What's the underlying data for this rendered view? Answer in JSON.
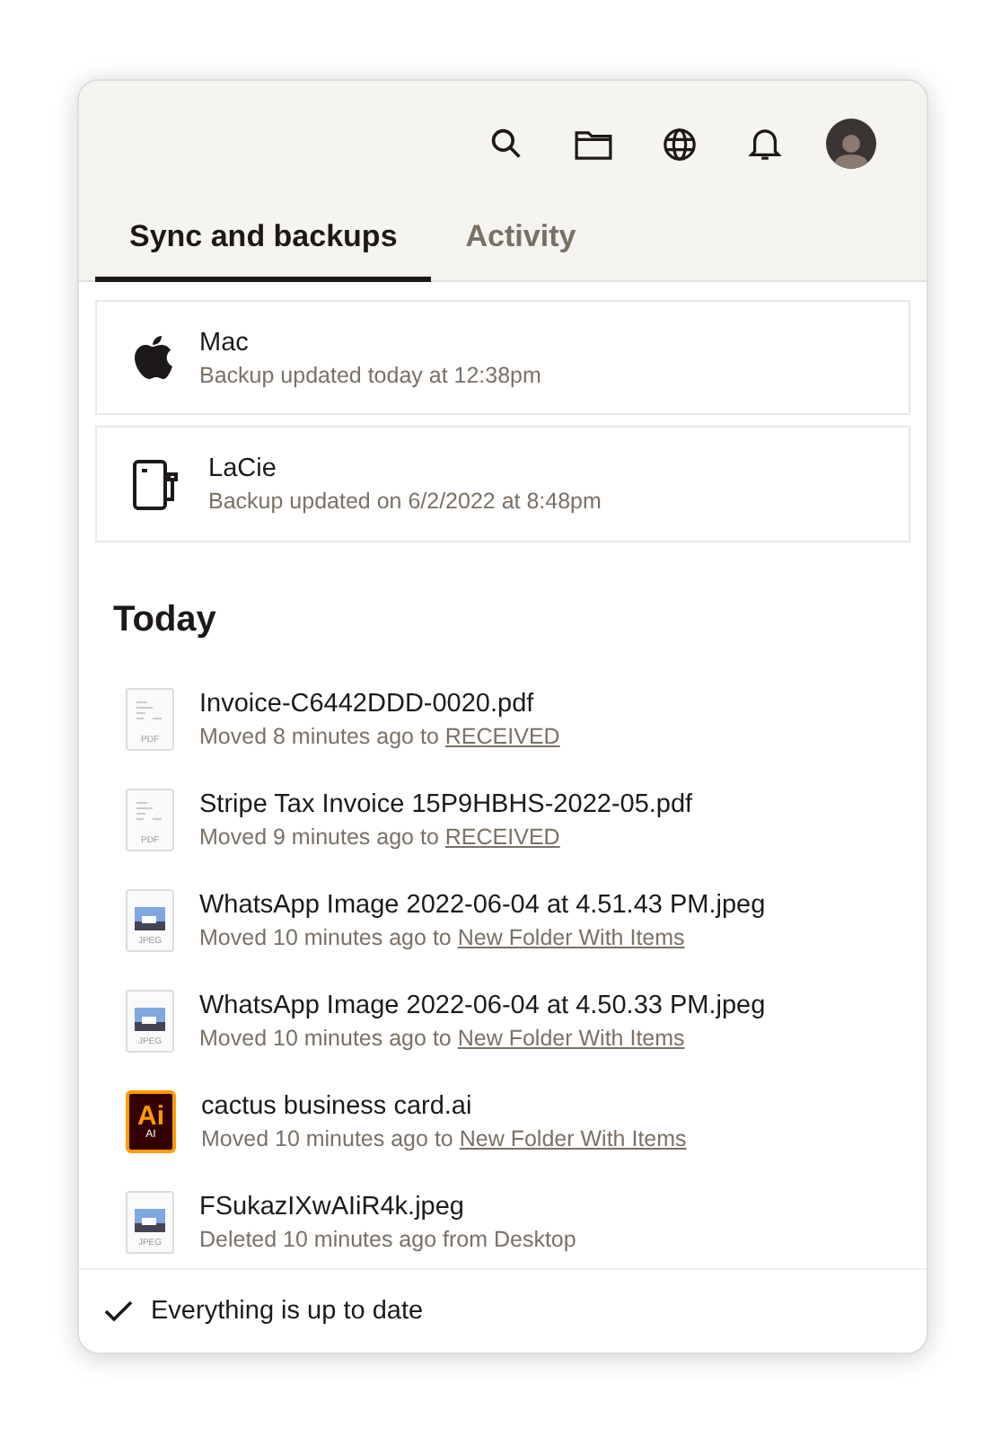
{
  "tabs": [
    {
      "label": "Sync and backups",
      "selected": true
    },
    {
      "label": "Activity",
      "selected": false
    }
  ],
  "devices": [
    {
      "kind": "computer",
      "name": "Mac",
      "status": "Backup updated today at 12:38pm"
    },
    {
      "kind": "drive",
      "name": "LaCie",
      "status": "Backup updated on 6/2/2022 at 8:48pm"
    }
  ],
  "section_title": "Today",
  "files": [
    {
      "kind": "pdf",
      "type_label": "PDF",
      "name": "Invoice-C6442DDD-0020.pdf",
      "detail": "Moved 8 minutes ago to",
      "link": "RECEIVED"
    },
    {
      "kind": "pdf",
      "type_label": "PDF",
      "name": "Stripe Tax Invoice 15P9HBHS-2022-05.pdf",
      "detail": "Moved 9 minutes ago to",
      "link": "RECEIVED"
    },
    {
      "kind": "image",
      "type_label": "JPEG",
      "name": "WhatsApp Image 2022-06-04 at 4.51.43 PM.jpeg",
      "detail": "Moved 10 minutes ago to",
      "link": "New Folder With Items"
    },
    {
      "kind": "image",
      "type_label": "JPEG",
      "name": "WhatsApp Image 2022-06-04 at 4.50.33 PM.jpeg",
      "detail": "Moved 10 minutes ago to",
      "link": "New Folder With Items"
    },
    {
      "kind": "ai",
      "logo": "Ai",
      "type_label": "AI",
      "name": "cactus business card.ai",
      "detail": "Moved 10 minutes ago to",
      "link": "New Folder With Items"
    },
    {
      "kind": "image",
      "type_label": "JPEG",
      "name": "FSukazIXwAIiR4k.jpeg",
      "detail": "Deleted 10 minutes ago from Desktop"
    }
  ],
  "footer": {
    "status": "Everything is up to date"
  }
}
